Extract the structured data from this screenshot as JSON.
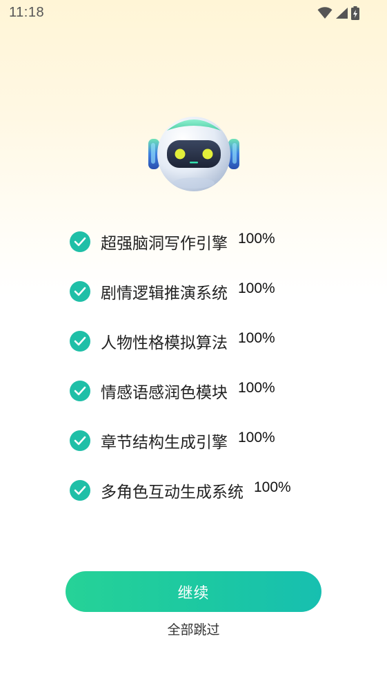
{
  "status_bar": {
    "time": "11:18",
    "icons": [
      "wifi-icon",
      "signal-icon",
      "battery-charging-icon"
    ]
  },
  "robot": {
    "icon": "robot-mascot-icon"
  },
  "features": [
    {
      "label": "超强脑洞写作引擎",
      "value": "100%",
      "icon": "check-circle-icon"
    },
    {
      "label": "剧情逻辑推演系统",
      "value": "100%",
      "icon": "check-circle-icon"
    },
    {
      "label": "人物性格模拟算法",
      "value": "100%",
      "icon": "check-circle-icon"
    },
    {
      "label": "情感语感润色模块",
      "value": "100%",
      "icon": "check-circle-icon"
    },
    {
      "label": "章节结构生成引擎",
      "value": "100%",
      "icon": "check-circle-icon"
    },
    {
      "label": "多角色互动生成系统",
      "value": "100%",
      "icon": "check-circle-icon"
    }
  ],
  "actions": {
    "continue_label": "继续",
    "skip_label": "全部跳过"
  },
  "colors": {
    "accent": "#1fbfa7",
    "button_gradient_start": "#26d297",
    "button_gradient_end": "#17bfb0",
    "background_top": "#fff5d6"
  }
}
